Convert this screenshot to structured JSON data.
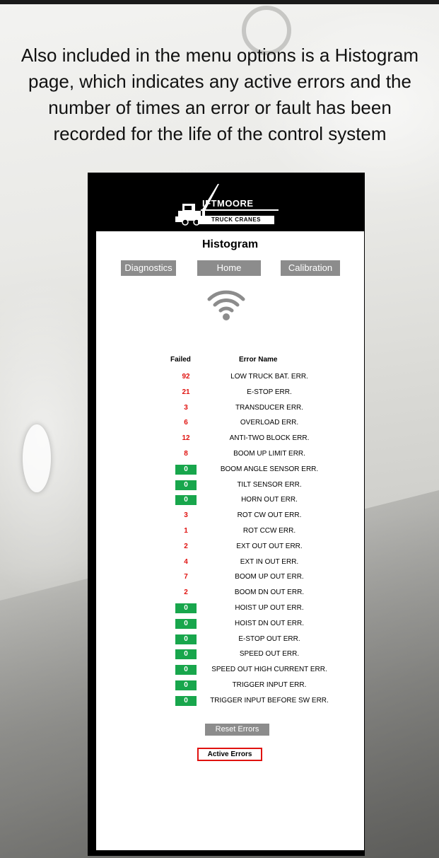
{
  "caption": {
    "lines": [
      "Also included in the menu options is a Histogram",
      "page, which indicates any active errors and the",
      "number of times an error or fault has been",
      "recorded for the life of the control system"
    ]
  },
  "logo": {
    "word": "IFTMOORE",
    "sub": "TRUCK CRANES"
  },
  "screen": {
    "title": "Histogram",
    "nav": {
      "diagnostics": "Diagnostics",
      "home": "Home",
      "calibration": "Calibration"
    },
    "columns": {
      "failed": "Failed",
      "error_name": "Error Name"
    },
    "errors": [
      {
        "count": "92",
        "name": "LOW TRUCK BAT. ERR.",
        "status": "bad"
      },
      {
        "count": "21",
        "name": "E-STOP ERR.",
        "status": "bad"
      },
      {
        "count": "3",
        "name": "TRANSDUCER ERR.",
        "status": "bad"
      },
      {
        "count": "6",
        "name": "OVERLOAD ERR.",
        "status": "bad"
      },
      {
        "count": "12",
        "name": "ANTI-TWO BLOCK ERR.",
        "status": "bad"
      },
      {
        "count": "8",
        "name": "BOOM UP LIMIT ERR.",
        "status": "bad"
      },
      {
        "count": "0",
        "name": "BOOM ANGLE SENSOR ERR.",
        "status": "ok"
      },
      {
        "count": "0",
        "name": "TILT SENSOR ERR.",
        "status": "ok"
      },
      {
        "count": "0",
        "name": "HORN OUT ERR.",
        "status": "ok"
      },
      {
        "count": "3",
        "name": "ROT CW OUT ERR.",
        "status": "bad"
      },
      {
        "count": "1",
        "name": "ROT CCW ERR.",
        "status": "bad"
      },
      {
        "count": "2",
        "name": "EXT OUT OUT ERR.",
        "status": "bad"
      },
      {
        "count": "4",
        "name": "EXT IN OUT ERR.",
        "status": "bad"
      },
      {
        "count": "7",
        "name": "BOOM UP OUT ERR.",
        "status": "bad"
      },
      {
        "count": "2",
        "name": "BOOM DN OUT ERR.",
        "status": "bad"
      },
      {
        "count": "0",
        "name": "HOIST UP OUT ERR.",
        "status": "ok"
      },
      {
        "count": "0",
        "name": "HOIST DN OUT ERR.",
        "status": "ok"
      },
      {
        "count": "0",
        "name": "E-STOP OUT ERR.",
        "status": "ok"
      },
      {
        "count": "0",
        "name": "SPEED OUT ERR.",
        "status": "ok"
      },
      {
        "count": "0",
        "name": "SPEED OUT HIGH CURRENT ERR.",
        "status": "ok"
      },
      {
        "count": "0",
        "name": "TRIGGER INPUT ERR.",
        "status": "ok"
      },
      {
        "count": "0",
        "name": "TRIGGER INPUT BEFORE SW ERR.",
        "status": "ok"
      }
    ],
    "reset_label": "Reset Errors",
    "active_label": "Active Errors"
  },
  "colors": {
    "error_count": "#e0120f",
    "ok_badge": "#18a64c",
    "nav_button": "#8c8c8c",
    "active_border": "#e0120f"
  },
  "icons": [
    "wifi-icon",
    "liftmoore-crane-logo"
  ]
}
